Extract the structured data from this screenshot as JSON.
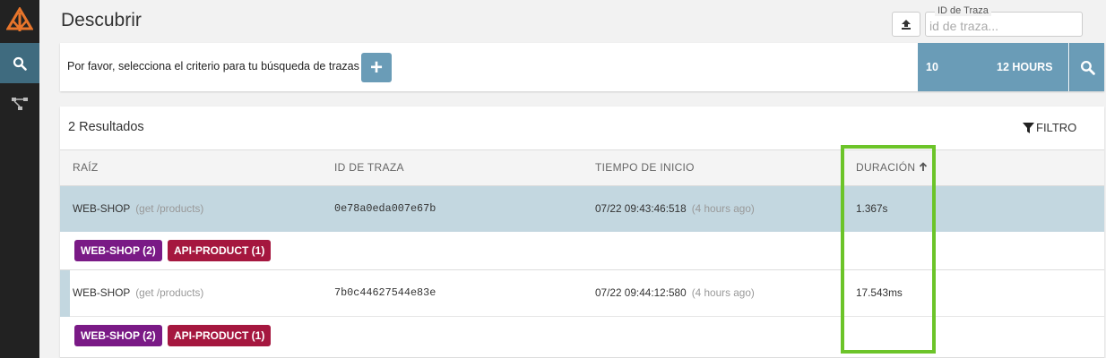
{
  "header": {
    "title": "Descubrir",
    "trace_id_label": "ID de Traza",
    "trace_id_placeholder": "id de traza..."
  },
  "search": {
    "criteria_prompt": "Por favor, selecciona el criterio para tu búsqueda de trazas",
    "add_label": "+",
    "limit": "10",
    "lookback": "12 HOURS"
  },
  "results": {
    "count_label": "2 Resultados",
    "filter_label": "FILTRO",
    "columns": {
      "root": "RAÍZ",
      "trace_id": "ID DE TRAZA",
      "start_time": "TIEMPO DE INICIO",
      "duration": "DURACIÓN"
    },
    "rows": [
      {
        "root_service": "WEB-SHOP",
        "root_span": "(get /products)",
        "trace_id": "0e78a0eda007e67b",
        "start_time": "07/22 09:43:46:518",
        "start_relative": "(4 hours ago)",
        "duration": "1.367s",
        "tags": [
          {
            "label": "WEB-SHOP (2)",
            "color": "#7a1a86"
          },
          {
            "label": "API-PRODUCT (1)",
            "color": "#a5173f"
          }
        ]
      },
      {
        "root_service": "WEB-SHOP",
        "root_span": "(get /products)",
        "trace_id": "7b0c44627544e83e",
        "start_time": "07/22 09:44:12:580",
        "start_relative": "(4 hours ago)",
        "duration": "17.543ms",
        "tags": [
          {
            "label": "WEB-SHOP (2)",
            "color": "#7a1a86"
          },
          {
            "label": "API-PRODUCT (1)",
            "color": "#a5173f"
          }
        ]
      }
    ]
  },
  "colors": {
    "sidebar": "#222222",
    "accent": "#6a9cb7",
    "selected_row": "#c3d7e0",
    "highlight": "#6cc429"
  },
  "icons": {
    "logo": "zipkin-logo-icon",
    "search": "search-icon",
    "dependencies": "dependency-graph-icon",
    "upload": "upload-icon",
    "filter": "filter-funnel-icon",
    "sort": "arrow-up-icon"
  }
}
